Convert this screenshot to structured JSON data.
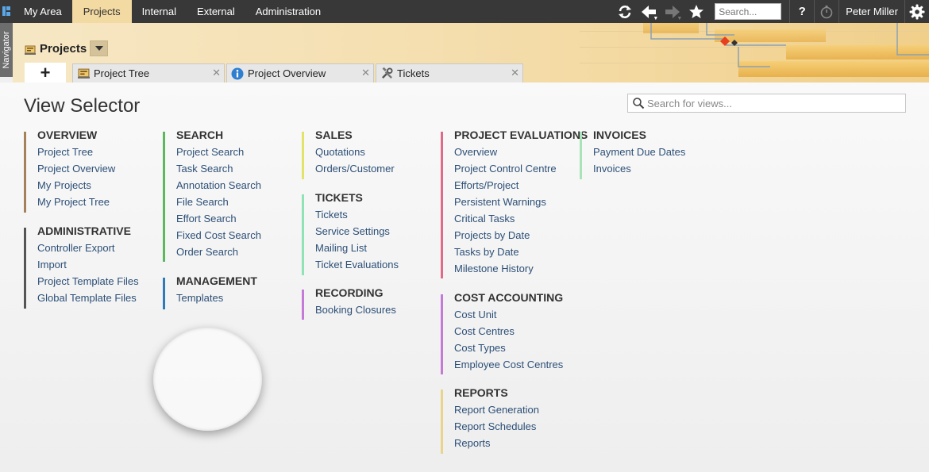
{
  "topnav": {
    "tabs": [
      {
        "label": "My Area"
      },
      {
        "label": "Projects"
      },
      {
        "label": "Internal"
      },
      {
        "label": "External"
      },
      {
        "label": "Administration"
      }
    ],
    "active_tab": "Projects"
  },
  "toolbar": {
    "refresh_icon": "refresh-icon",
    "back_icon": "arrow-left-icon",
    "forward_icon": "arrow-right-icon",
    "favorites_icon": "star-icon",
    "search_placeholder": "Search...",
    "help_label": "?",
    "timer_icon": "stopwatch-icon",
    "user_name": "Peter Miller",
    "settings_icon": "gear-icon"
  },
  "navigator": {
    "label": "Navigator"
  },
  "header": {
    "title": "Projects",
    "add_tab_label": "+",
    "tabs": [
      {
        "label": "Project Tree",
        "icon": "project-tree-icon"
      },
      {
        "label": "Project Overview",
        "icon": "info-icon"
      },
      {
        "label": "Tickets",
        "icon": "tools-icon"
      }
    ]
  },
  "main": {
    "title": "View Selector",
    "search_placeholder": "Search for views...",
    "groups": [
      {
        "heading": "OVERVIEW",
        "color": "#a6825a",
        "items": [
          "Project Tree",
          "Project Overview",
          "My Projects",
          "My Project Tree"
        ]
      },
      {
        "heading": "ADMINISTRATIVE",
        "color": "#555555",
        "items": [
          "Controller Export",
          "Import",
          "Project Template Files",
          "Global Template Files"
        ]
      },
      {
        "heading": "SEARCH",
        "color": "#5cb85c",
        "items": [
          "Project Search",
          "Task Search",
          "Annotation Search",
          "File Search",
          "Effort Search",
          "Fixed Cost Search",
          "Order Search"
        ]
      },
      {
        "heading": "MANAGEMENT",
        "color": "#2f7ab8",
        "items": [
          "Templates"
        ]
      },
      {
        "heading": "SALES",
        "color": "#e3e36a",
        "items": [
          "Quotations",
          "Orders/Customer"
        ]
      },
      {
        "heading": "TICKETS",
        "color": "#8fe3b4",
        "items": [
          "Tickets",
          "Service Settings",
          "Mailing List",
          "Ticket Evaluations"
        ]
      },
      {
        "heading": "RECORDING",
        "color": "#c57ad8",
        "items": [
          "Booking Closures"
        ]
      },
      {
        "heading": "PROJECT EVALUATIONS",
        "color": "#df6a8a",
        "items": [
          "Overview",
          "Project Control Centre",
          "Efforts/Project",
          "Persistent Warnings",
          "Critical Tasks",
          "Projects by Date",
          "Tasks by Date",
          "Milestone History"
        ]
      },
      {
        "heading": "COST ACCOUNTING",
        "color": "#c57ad8",
        "items": [
          "Cost Unit",
          "Cost Centres",
          "Cost Types",
          "Employee Cost Centres"
        ]
      },
      {
        "heading": "REPORTS",
        "color": "#e8d48a",
        "items": [
          "Report Generation",
          "Report Schedules",
          "Reports"
        ]
      },
      {
        "heading": "INVOICES",
        "color": "#a9e3b8",
        "items": [
          "Payment Due Dates",
          "Invoices"
        ]
      }
    ]
  }
}
